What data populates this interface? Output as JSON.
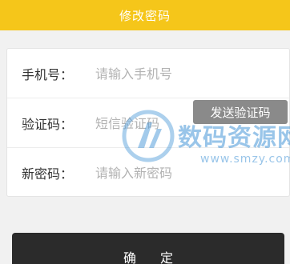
{
  "header": {
    "title": "修改密码"
  },
  "form": {
    "phone": {
      "label": "手机号：",
      "placeholder": "请输入手机号"
    },
    "code": {
      "label": "验证码：",
      "placeholder": "短信验证码",
      "send_label": "发送验证码"
    },
    "password": {
      "label": "新密码：",
      "placeholder": "请输入新密码"
    }
  },
  "actions": {
    "confirm_label": "确定"
  },
  "watermark": {
    "text": "数码资源网",
    "url": "www.smzy.com"
  },
  "colors": {
    "header": "#f5c61a",
    "send_button": "#8a8a8a",
    "confirm_button": "#2b2b2b"
  }
}
